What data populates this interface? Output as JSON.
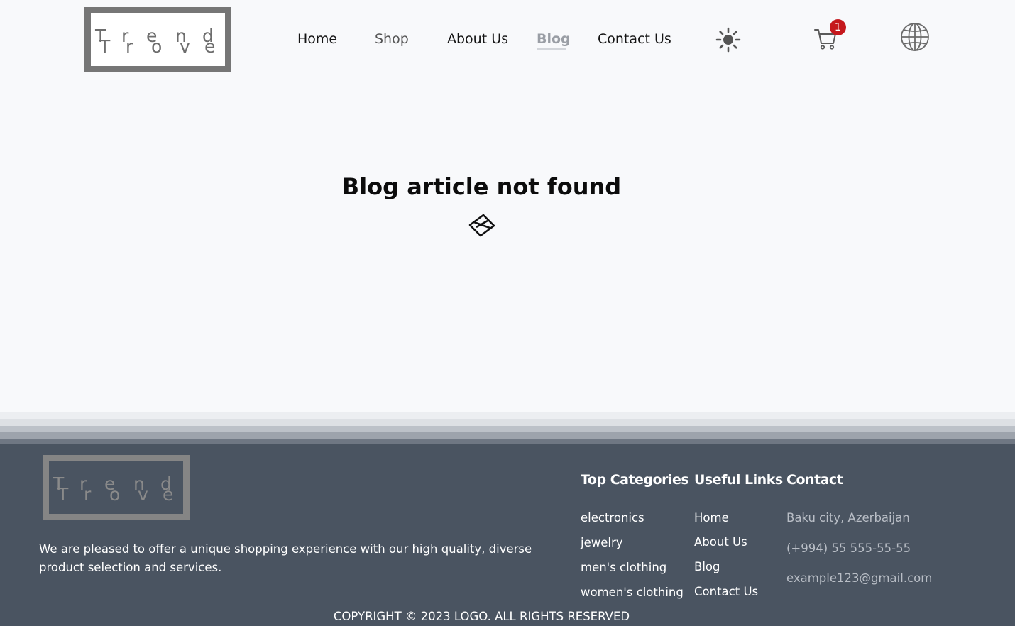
{
  "brand": {
    "logo_letters_top": [
      "T",
      "r",
      "e",
      "n",
      "d"
    ],
    "logo_letters_bottom": [
      "T",
      "r",
      "o",
      "v",
      "e"
    ]
  },
  "nav": {
    "items": [
      {
        "label": "Home"
      },
      {
        "label": "Shop"
      },
      {
        "label": "About Us"
      },
      {
        "label": "Blog"
      },
      {
        "label": "Contact Us"
      }
    ],
    "active": "Blog",
    "cart_count": "1",
    "icons": [
      "theme-toggle-sun-icon",
      "cart-icon",
      "globe-language-icon"
    ]
  },
  "main": {
    "message": "Blog article not found",
    "icon": "broken-paper-icon"
  },
  "footer": {
    "description": "We are pleased to offer a unique shopping experience with our high quality, diverse product selection and services.",
    "columns": {
      "categories": {
        "title": "Top Categories",
        "items": [
          "electronics",
          "jewelry",
          "men's clothing",
          "women's clothing"
        ]
      },
      "links": {
        "title": "Useful Links",
        "items": [
          "Home",
          "About Us",
          "Blog",
          "Contact Us"
        ]
      },
      "contact": {
        "title": "Contact",
        "items": [
          "Baku city, Azerbaijan",
          "(+994) 55 555-55-55",
          "example123@gmail.com"
        ]
      }
    },
    "copyright": "COPYRIGHT © 2023 LOGO. ALL RIGHTS RESERVED"
  },
  "colors": {
    "background": "#f8f9fb",
    "footer": "#4a5461",
    "badge": "#c5181d",
    "logo_border": "#767676"
  }
}
